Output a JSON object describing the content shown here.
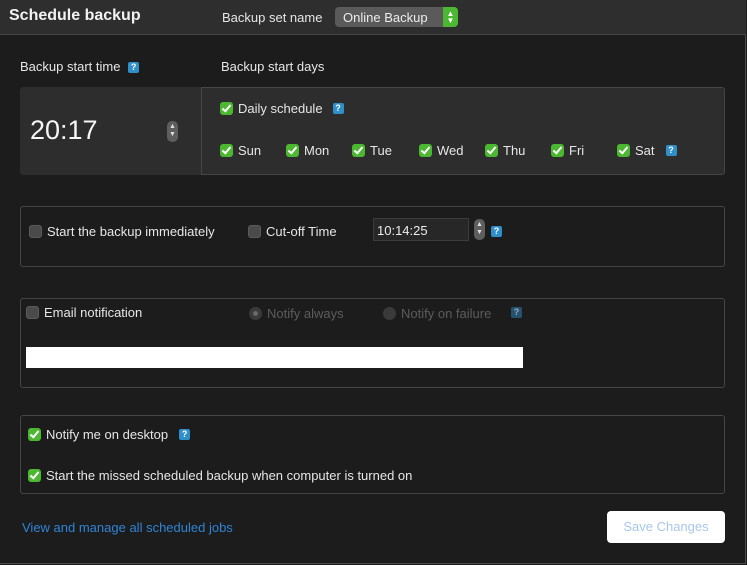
{
  "header": {
    "title": "Schedule backup",
    "backup_set_label": "Backup set name",
    "backup_set_value": "Online Backup"
  },
  "start_time": {
    "label": "Backup start time",
    "value": "20:17"
  },
  "start_days": {
    "label": "Backup start days",
    "daily_schedule": {
      "label": "Daily schedule",
      "checked": true
    },
    "days": [
      {
        "label": "Sun",
        "checked": true
      },
      {
        "label": "Mon",
        "checked": true
      },
      {
        "label": "Tue",
        "checked": true
      },
      {
        "label": "Wed",
        "checked": true
      },
      {
        "label": "Thu",
        "checked": true
      },
      {
        "label": "Fri",
        "checked": true
      },
      {
        "label": "Sat",
        "checked": true
      }
    ]
  },
  "immediate": {
    "start_immediately_label": "Start the backup immediately",
    "start_immediately_checked": false,
    "cutoff_label": "Cut-off Time",
    "cutoff_checked": false,
    "cutoff_value": "10:14:25"
  },
  "email": {
    "label": "Email notification",
    "checked": false,
    "notify_always": "Notify always",
    "notify_on_failure": "Notify on failure",
    "selected": "Notify always",
    "address_value": ""
  },
  "desktop": {
    "notify_label": "Notify me on desktop",
    "notify_checked": true,
    "missed_label": "Start the missed scheduled backup when computer is turned on",
    "missed_checked": true
  },
  "footer": {
    "link_label": "View and manage all scheduled jobs",
    "save_label": "Save Changes"
  },
  "icons": {
    "help": "?",
    "stepper": "⌃⌄"
  },
  "colors": {
    "accent_green": "#4cb731",
    "help_blue": "#2e8fc9",
    "link_blue": "#2f84d6"
  }
}
